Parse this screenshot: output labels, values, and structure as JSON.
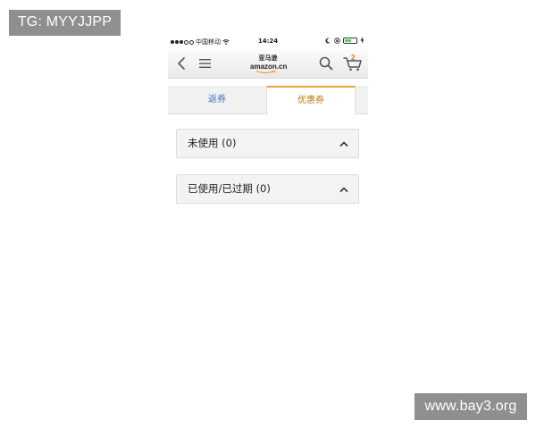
{
  "watermarks": {
    "top_left": "TG: MYYJJPP",
    "bottom_right": "www.bay3.org"
  },
  "status_bar": {
    "carrier": "中国移动",
    "time": "14:24",
    "battery_level": 0.55,
    "battery_color": "#4cd964"
  },
  "navbar": {
    "logo_cn": "亚马逊",
    "logo_en": "amazon.cn",
    "cart_count": "2",
    "icons": [
      "chevron-left-icon",
      "menu-icon",
      "search-icon",
      "cart-icon"
    ]
  },
  "tabs": [
    {
      "label": "返券",
      "active": false
    },
    {
      "label": "优惠券",
      "active": true
    }
  ],
  "sections": [
    {
      "label": "未使用 (0)",
      "expanded": true
    },
    {
      "label": "已使用/已过期 (0)",
      "expanded": true
    }
  ],
  "colors": {
    "tab_link": "#3d7ab8",
    "tab_active": "#c07a12",
    "tab_active_border": "#e9a43b",
    "cart_count": "#e47911"
  }
}
